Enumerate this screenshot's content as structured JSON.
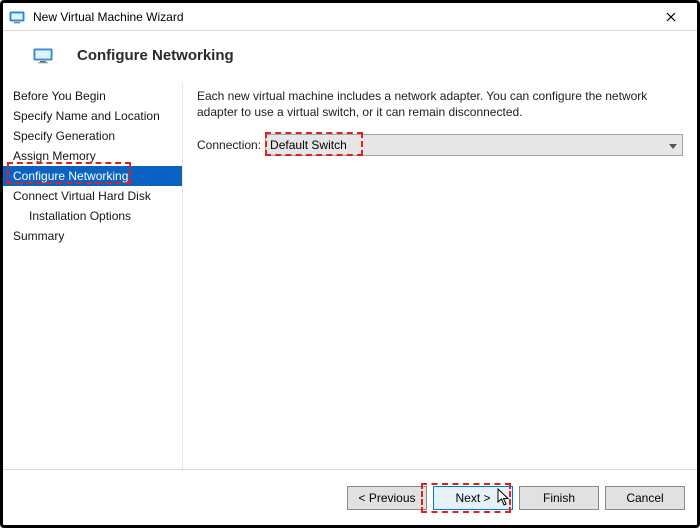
{
  "window": {
    "title": "New Virtual Machine Wizard"
  },
  "header": {
    "heading": "Configure Networking"
  },
  "sidebar": {
    "items": [
      {
        "label": "Before You Begin"
      },
      {
        "label": "Specify Name and Location"
      },
      {
        "label": "Specify Generation"
      },
      {
        "label": "Assign Memory"
      },
      {
        "label": "Configure Networking",
        "selected": true
      },
      {
        "label": "Connect Virtual Hard Disk"
      },
      {
        "label": "Installation Options",
        "indent": true
      },
      {
        "label": "Summary"
      }
    ]
  },
  "content": {
    "description": "Each new virtual machine includes a network adapter. You can configure the network adapter to use a virtual switch, or it can remain disconnected.",
    "connection_label": "Connection:",
    "connection_value": "Default Switch"
  },
  "footer": {
    "previous": "< Previous",
    "next": "Next >",
    "finish": "Finish",
    "cancel": "Cancel"
  }
}
